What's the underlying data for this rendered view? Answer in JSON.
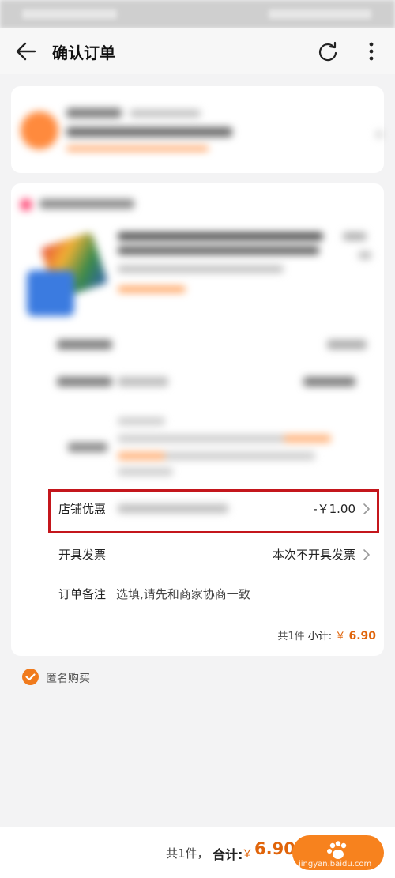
{
  "header": {
    "title": "确认订单"
  },
  "order": {
    "store_discount": {
      "label": "店铺优惠",
      "value": "-￥1.00"
    },
    "invoice": {
      "label": "开具发票",
      "value": "本次不开具发票"
    },
    "note": {
      "label": "订单备注",
      "placeholder": "选填,请先和商家协商一致"
    },
    "subtotal": {
      "count_text": "共1件",
      "label": "小计:",
      "currency": "￥",
      "amount": "6.90"
    }
  },
  "anonymous": {
    "label": "匿名购买",
    "checked": true
  },
  "footer": {
    "count_text": "共1件，",
    "total_label": "合计:",
    "currency": "￥",
    "amount": "6.90",
    "watermark": "jingyan.baidu.com"
  },
  "colors": {
    "accent": "#f7821e",
    "price": "#e0640a",
    "highlight_border": "#c4161c"
  }
}
